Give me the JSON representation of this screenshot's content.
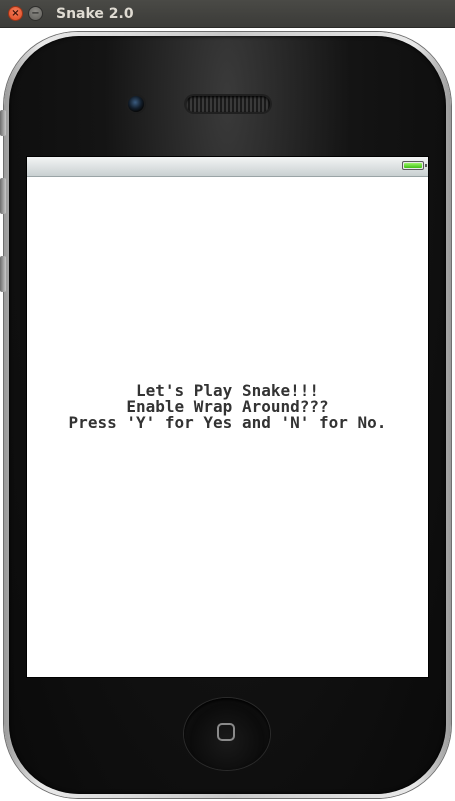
{
  "window": {
    "title": "Snake 2.0",
    "close_glyph": "×",
    "minimize_glyph": "−"
  },
  "screen": {
    "battery_level": 1.0,
    "message_lines": [
      "Let's Play Snake!!!",
      "Enable Wrap Around???",
      "Press 'Y' for Yes and 'N' for No."
    ]
  },
  "colors": {
    "titlebar": "#3b3b38",
    "close_button": "#dd4a22",
    "screen_background": "#ffffff",
    "text": "#333333",
    "battery_fill": "#3fbf14"
  },
  "icons": {
    "close": "close-icon",
    "minimize": "minimize-icon",
    "battery": "battery-icon",
    "home": "home-square-icon",
    "camera": "camera-icon",
    "speaker": "speaker-grille"
  }
}
